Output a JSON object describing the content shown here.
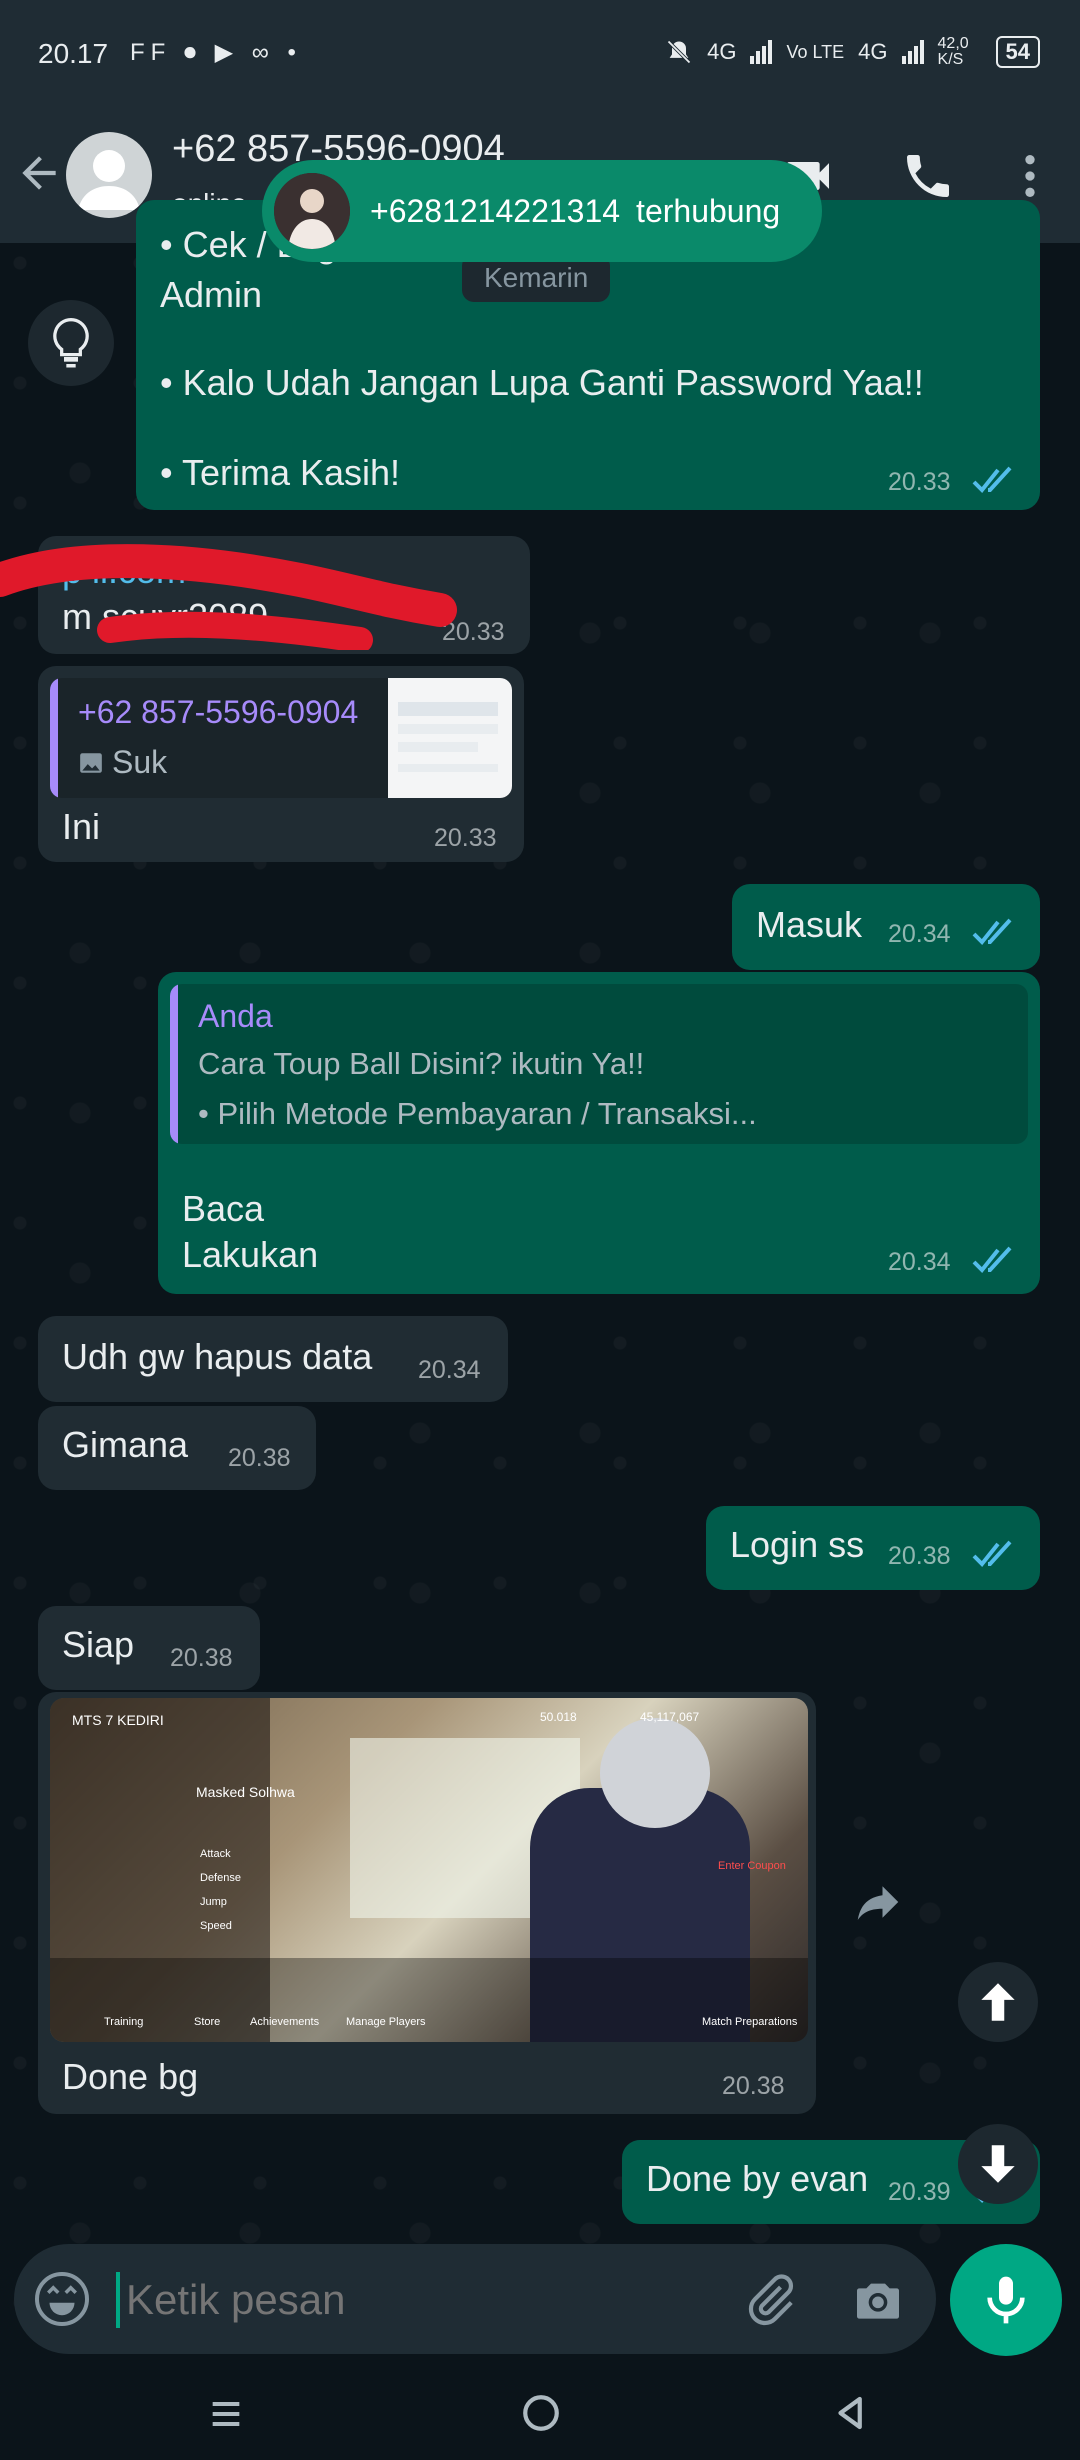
{
  "status_bar": {
    "time": "20.17",
    "left_icons": "FF ⏺ ▶ ∞ •",
    "network_4g_1": "4G",
    "volte": "Vo LTE",
    "network_4g_2": "4G",
    "speed": "42,0 K/S",
    "battery": "54"
  },
  "header": {
    "contact": "+62 857-5596-0904",
    "status": "online"
  },
  "call_banner": {
    "number": "+6281214221314",
    "state": "terhubung"
  },
  "date_chip": "Kemarin",
  "messages": {
    "m1": {
      "partial_top": "• Cek / Log                                es Oleh",
      "line2": "Admin",
      "line3": "• Kalo Udah Jangan Lupa Ganti Password Yaa!!",
      "line4": "• Terima Kasih!",
      "time": "20.33"
    },
    "m2": {
      "line1": "p                 il.com",
      "line2": "m  scuyr2089",
      "time": "20.33"
    },
    "m3": {
      "reply_name": "+62 857-5596-0904",
      "reply_text": "Suk",
      "text": "Ini",
      "time": "20.33"
    },
    "m4": {
      "text": "Masuk",
      "time": "20.34"
    },
    "m5": {
      "reply_name": "Anda",
      "reply_line1": "Cara Toup Ball Disini? ikutin Ya!!",
      "reply_line2": "• Pilih Metode Pembayaran / Transaksi...",
      "line1": "Baca",
      "line2": "Lakukan",
      "time": "20.34"
    },
    "m6": {
      "text": "Udh gw hapus data",
      "time": "20.34"
    },
    "m7": {
      "text": "Gimana",
      "time": "20.38"
    },
    "m8": {
      "text": "Login ss",
      "time": "20.38"
    },
    "m9": {
      "text": "Siap",
      "time": "20.38"
    },
    "m10": {
      "caption": "Done bg",
      "time": "20.38",
      "game": {
        "team": "MTS 7 KEDIRI",
        "player": "Masked Solhwa",
        "coins1": "50.018",
        "coins2": "45,117,067",
        "stat_attack": "Attack",
        "stat_defense": "Defense",
        "stat_jump": "Jump",
        "stat_speed": "Speed",
        "menu_training": "Training",
        "menu_store": "Store",
        "menu_achievements": "Achievements",
        "menu_manage": "Manage Players",
        "menu_match": "Match Preparations",
        "coupon": "Enter Coupon"
      }
    },
    "m11": {
      "text": "Done by evan",
      "time": "20.39"
    }
  },
  "composer": {
    "placeholder": "Ketik pesan"
  },
  "colors": {
    "incoming": "#202c33",
    "outgoing": "#005c4b",
    "accent": "#00a884",
    "read_ticks": "#53bdeb"
  }
}
